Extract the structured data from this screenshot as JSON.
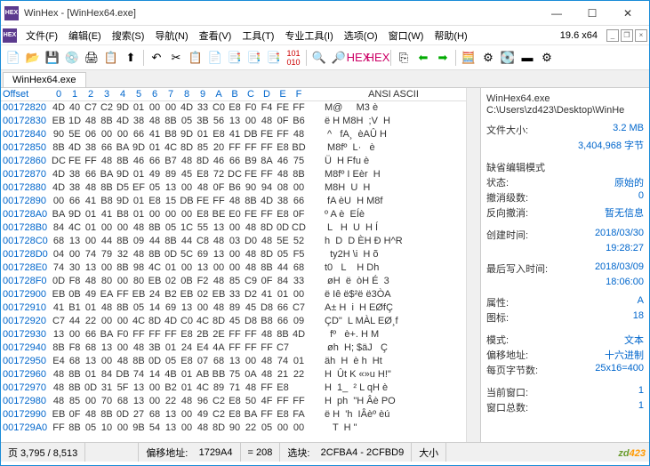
{
  "window": {
    "title": "WinHex - [WinHex64.exe]"
  },
  "menubar": {
    "items": [
      "文件(F)",
      "编辑(E)",
      "搜索(S)",
      "导航(N)",
      "查看(V)",
      "工具(T)",
      "专业工具(I)",
      "选项(O)",
      "窗口(W)",
      "帮助(H)"
    ],
    "version": "19.6 x64"
  },
  "tab": {
    "label": "WinHex64.exe"
  },
  "hex": {
    "offset_label": "Offset",
    "byte_cols": [
      "0",
      "1",
      "2",
      "3",
      "4",
      "5",
      "6",
      "7",
      "8",
      "9",
      "A",
      "B",
      "C",
      "D",
      "E",
      "F"
    ],
    "ascii_label": "ANSI ASCII",
    "rows": [
      {
        "o": "00172820",
        "b": "4D 40 C7 C2 9D 01 00 00 4D 33 C0 E8 F0 F4 FE FF",
        "a": "M@     M3 è"
      },
      {
        "o": "00172830",
        "b": "EB 1D 48 8B 4D 38 48 8B 05 3B 56 13 00 48 0F B6",
        "a": "ë H M8H  ;V  H"
      },
      {
        "o": "00172840",
        "b": "90 5E 06 00 00 66 41 B8 9D 01 E8 41 DB FE FF 48",
        "a": " ^   fA¸  èAÛ H"
      },
      {
        "o": "00172850",
        "b": "8B 4D 38 66 BA 9D 01 4C 8D 85 20 FF FF FF E8 BD",
        "a": " M8fº  L·   è"
      },
      {
        "o": "00172860",
        "b": "DC FE FF 48 8B 46 66 B7 48 8D 46 66 B9 8A 46 75",
        "a": "Ü  H Ffu è"
      },
      {
        "o": "00172870",
        "b": "4D 38 66 BA 9D 01 49 89 45 E8 72 DC FE FF 48 8B",
        "a": "M8fº I Eèr  H"
      },
      {
        "o": "00172880",
        "b": "4D 38 48 8B D5 EF 05 13 00 48 0F B6 90 94 08 00",
        "a": "M8H  U  H"
      },
      {
        "o": "00172890",
        "b": "00 66 41 B8 9D 01 E8 15 DB FE FF 48 8B 4D 38 66",
        "a": " fA èU  H M8f"
      },
      {
        "o": "001728A0",
        "b": "BA 9D 01 41 B8 01 00 00 00 E8 BE E0 FE FF E8 0F",
        "a": "º A è  EÍè"
      },
      {
        "o": "001728B0",
        "b": "84 4C 01 00 00 48 8B 05 1C 55 13 00 48 8D 0D CD",
        "a": " L   H  U  H Í"
      },
      {
        "o": "001728C0",
        "b": "68 13 00 44 8B 09 44 8B 44 C8 48 03 D0 48 5E 52",
        "a": "h  D  D ÈH Ð H^R"
      },
      {
        "o": "001728D0",
        "b": "04 00 74 79 32 48 8B 0D 5C 69 13 00 48 8D 05 F5",
        "a": "  ty2H \\i  H õ"
      },
      {
        "o": "001728E0",
        "b": "74 30 13 00 8B 98 4C 01 00 13 00 00 48 8B 44 68",
        "a": "t0   L    H Dh"
      },
      {
        "o": "001728F0",
        "b": "0D F8 48 80 00 80 EB 02 0B F2 48 85 C9 0F 84 33",
        "a": " øH  ë  òH É  3"
      },
      {
        "o": "00172900",
        "b": "EB 0B 49 EA FF EB 24 B2 EB 02 EB 33 D2 41 01 00",
        "a": "ë Iê ë$²ë ë3ÒA"
      },
      {
        "o": "00172910",
        "b": "41 B1 01 48 8B 05 14 69 13 00 48 89 45 D8 66 C7",
        "a": "A± H  i  H EØfÇ"
      },
      {
        "o": "00172920",
        "b": "C7 44 22 00 00 4C 8D 4D C0 4C 8D 45 D8 B8 66 09",
        "a": "ÇD\"  L MÀL EØ¸f"
      },
      {
        "o": "00172930",
        "b": "13 00 66 BA F0 FF FF FF E8 2B 2E FF FF 48 8B 4D",
        "a": "  fº   è+. H M"
      },
      {
        "o": "00172940",
        "b": "8B F8 68 13 00 48 3B 01 24 E4 4A FF FF FF C7",
        "a": " øh  H; $äJ   Ç"
      },
      {
        "o": "00172950",
        "b": "E4 68 13 00 48 8B 0D 05 E8 07 68 13 00 48 74 01",
        "a": "äh  H  è h  Ht"
      },
      {
        "o": "00172960",
        "b": "48 8B 01 84 DB 74 14 4B 01 AB BB 75 0A 48 21 22",
        "a": "H  Ût K «»u H!\""
      },
      {
        "o": "00172970",
        "b": "48 8B 0D 31 5F 13 00 B2 01 4C 89 71 48 FF E8",
        "a": "H  1_  ² L qH è"
      },
      {
        "o": "00172980",
        "b": "48 85 00 70 68 13 00 22 48 96 C2 E8 50 4F FF FF",
        "a": "H  ph  \"H Âè PO"
      },
      {
        "o": "00172990",
        "b": "EB 0F 48 8B 0D 27 68 13 00 49 C2 E8 BA FF E8 FA",
        "a": "ë H  'h  IÂèº èú"
      },
      {
        "o": "001729A0",
        "b": "FF 8B 05 10 00 9B 54 13 00 48 8D 90 22 05 00 00",
        "a": "   T  H \"  "
      }
    ]
  },
  "side": {
    "filename": "WinHex64.exe",
    "filepath": "C:\\Users\\zd423\\Desktop\\WinHe",
    "props": [
      {
        "label": "文件大小:",
        "value": "3.2 MB"
      },
      {
        "label": "",
        "value": "3,404,968 字节"
      }
    ],
    "props2": [
      {
        "label": "缺省编辑模式",
        "value": ""
      },
      {
        "label": "状态:",
        "value": "原始的"
      },
      {
        "label": "撤消级数:",
        "value": "0"
      },
      {
        "label": "反向撤消:",
        "value": "暂无信息"
      }
    ],
    "props3": [
      {
        "label": "创建时间:",
        "value": "2018/03/30"
      },
      {
        "label": "",
        "value": "19:28:27"
      }
    ],
    "props4": [
      {
        "label": "最后写入时间:",
        "value": "2018/03/09"
      },
      {
        "label": "",
        "value": "18:06:00"
      }
    ],
    "props5": [
      {
        "label": "属性:",
        "value": "A"
      },
      {
        "label": "图标:",
        "value": "18"
      }
    ],
    "props6": [
      {
        "label": "模式:",
        "value": "文本"
      },
      {
        "label": "偏移地址:",
        "value": "十六进制"
      },
      {
        "label": "每页字节数:",
        "value": "25x16=400"
      }
    ],
    "props7": [
      {
        "label": "当前窗口:",
        "value": "1"
      },
      {
        "label": "窗口总数:",
        "value": "1"
      }
    ]
  },
  "status": {
    "page": "页 3,795 / 8,513",
    "offset_label": "偏移地址:",
    "offset_value": "1729A4",
    "eq": "= 208",
    "sel_label": "选块:",
    "sel_value": "2CFBA4 - 2CFBD9",
    "size_label": "大小"
  }
}
